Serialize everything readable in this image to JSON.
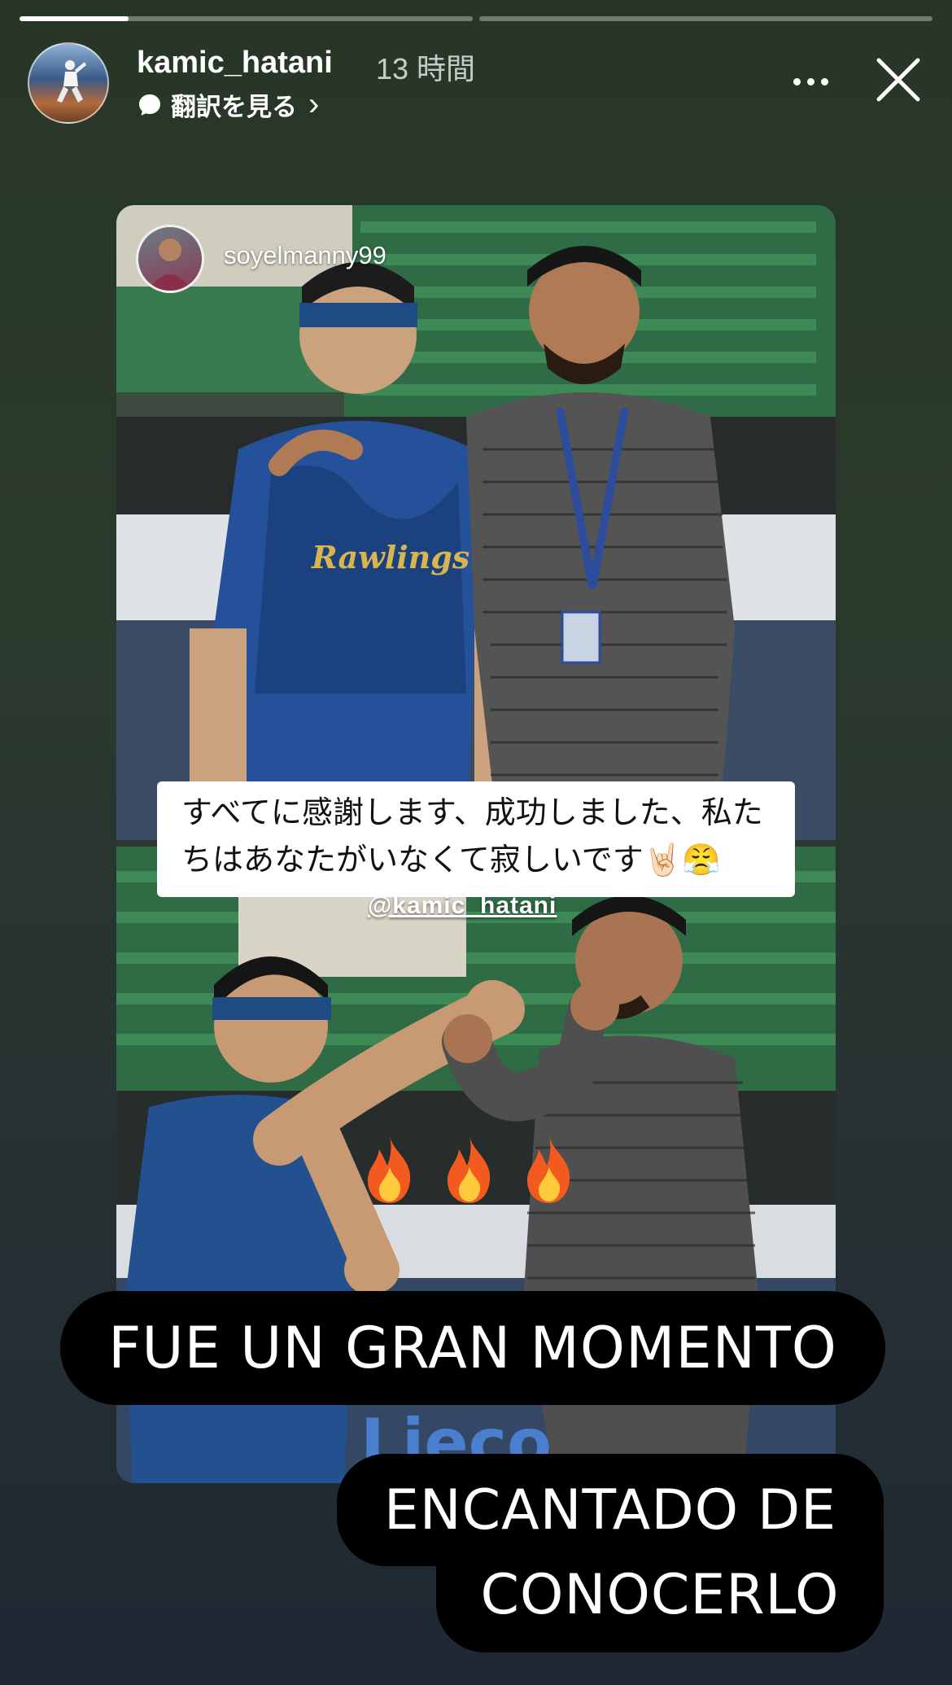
{
  "story": {
    "progress": [
      0.24,
      0
    ],
    "username": "kamic_hatani",
    "time": "13 時間",
    "translate_label": "翻訳を見る",
    "translate_chevron": "›"
  },
  "repost": {
    "username": "soyelmanny99",
    "caption_jp": "すべてに感謝します、成功しました、私たちはあなたがいなくて寂しいです🤘🏻😤",
    "mention": "@kamic_hatani",
    "emojis": [
      "fire-icon",
      "fire-icon",
      "fire-icon"
    ]
  },
  "text_stickers": {
    "line1": "FUE UN GRAN MOMENTO",
    "line2": "ENCANTADO DE",
    "line3": "CONOCERLO"
  },
  "icons": {
    "more": "more-icon",
    "close": "close-icon",
    "translate": "speech-bubble-icon"
  },
  "colors": {
    "background_top": "#273626",
    "background_bottom": "#1f2833",
    "sticker_bg": "#000000",
    "caption_bg": "#ffffff"
  }
}
